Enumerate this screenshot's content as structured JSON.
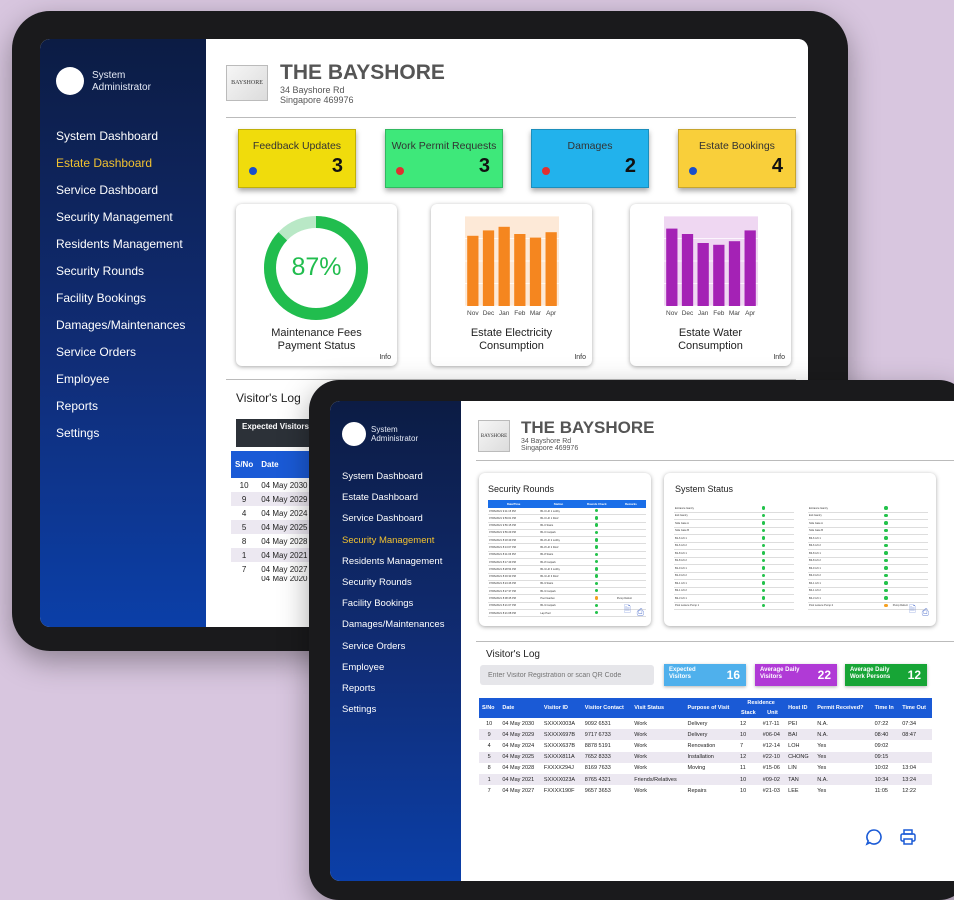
{
  "admin_label": "System Administrator",
  "nav_items": [
    "System Dashboard",
    "Estate Dashboard",
    "Service Dashboard",
    "Security Management",
    "Residents Management",
    "Security Rounds",
    "Facility Bookings",
    "Damages/Maintenances",
    "Service Orders",
    "Employee",
    "Reports",
    "Settings"
  ],
  "property": {
    "logo_text": "BAYSHORE",
    "name": "THE BAYSHORE",
    "address1": "34 Bayshore Rd",
    "address2": "Singapore 469976"
  },
  "tablet1": {
    "active_nav": "Estate Dashboard",
    "cards": [
      {
        "label": "Feedback Updates",
        "count": "3",
        "bg": "#f0dc0c",
        "dot": "#1a4fc9"
      },
      {
        "label": "Work Permit Requests",
        "count": "3",
        "bg": "#3ee87a",
        "dot": "#e03030"
      },
      {
        "label": "Damages",
        "count": "2",
        "bg": "#22b2ec",
        "dot": "#e03030"
      },
      {
        "label": "Estate Bookings",
        "count": "4",
        "bg": "#f9cf3a",
        "dot": "#1a4fc9"
      }
    ],
    "maintenance": {
      "percent_label": "87%",
      "value": 0.87,
      "title1": "Maintenance Fees",
      "title2": "Payment Status",
      "info": "Info"
    },
    "electricity": {
      "title1": "Estate Electricity",
      "title2": "Consumption",
      "info": "Info",
      "categories": [
        "Nov",
        "Dec",
        "Jan",
        "Feb",
        "Mar",
        "Apr"
      ],
      "values": [
        0.78,
        0.84,
        0.88,
        0.8,
        0.76,
        0.82
      ],
      "color": "#f5861f"
    },
    "water": {
      "title1": "Estate Water",
      "title2": "Consumption",
      "info": "Info",
      "categories": [
        "Nov",
        "Dec",
        "Jan",
        "Feb",
        "Mar",
        "Apr"
      ],
      "values": [
        0.86,
        0.8,
        0.7,
        0.68,
        0.72,
        0.84
      ],
      "color": "#a422b5"
    },
    "visitors_log": {
      "title": "Visitor's Log",
      "expected_label": "Expected Visitors",
      "columns": [
        "S/No",
        "Date"
      ],
      "rows": [
        [
          "10",
          "04 May 2030"
        ],
        [
          "9",
          "04 May 2029"
        ],
        [
          "4",
          "04 May 2024"
        ],
        [
          "5",
          "04 May 2025"
        ],
        [
          "8",
          "04 May 2028"
        ],
        [
          "1",
          "04 May 2021"
        ],
        [
          "7",
          "04 May 2027"
        ]
      ],
      "cut_row": "04 May 2020"
    }
  },
  "tablet2": {
    "active_nav": "Security Management",
    "security_rounds": {
      "title": "Security Rounds",
      "columns": [
        "Date/Time",
        "Station",
        "Rounds Check",
        "Remarks"
      ],
      "rows": [
        [
          "07/06/2021 9:11:15 PM",
          "B1-6 Lift 1 Lobby",
          "g",
          ""
        ],
        [
          "07/06/2021 9:59:01 PM",
          "B1-6 Lift 1 Roof",
          "g",
          ""
        ],
        [
          "07/06/2021 9:56:15 PM",
          "B1-6 Stairs",
          "g",
          ""
        ],
        [
          "07/06/2021 9:56:29 PM",
          "B1-6 Carpark",
          "g",
          ""
        ],
        [
          "07/06/2021 8:18:49 PM",
          "B1-8 Lift 2 Lobby",
          "g",
          ""
        ],
        [
          "07/06/2021 8:13:07 PM",
          "B1-8 Lift 2 Roof",
          "g",
          ""
        ],
        [
          "07/06/2021 8:11:06 PM",
          "B1-8 Stairs",
          "g",
          ""
        ],
        [
          "07/06/2021 8:17:49 PM",
          "B1-8 Carpark",
          "g",
          ""
        ],
        [
          "07/06/2021 8:28:54 PM",
          "B1-9 Lift 3 Lobby",
          "g",
          ""
        ],
        [
          "07/06/2021 8:03:33 PM",
          "B1-9 Lift 3 Roof",
          "g",
          ""
        ],
        [
          "07/06/2021 8:24:46 PM",
          "B1-9 Stairs",
          "g",
          ""
        ],
        [
          "07/06/2021 8:27:37 PM",
          "B1-9 Carpark",
          "g",
          ""
        ],
        [
          "07/06/2021 8:08:45 PM",
          "Pool Garden",
          "o",
          "Pump Defect"
        ],
        [
          "07/06/2021 8:21:07 PM",
          "B1-9 Carpark",
          "g",
          ""
        ],
        [
          "07/06/2021 8:21:08 PM",
          "Lap Pool",
          "g",
          ""
        ]
      ]
    },
    "system_status": {
      "title": "System Status",
      "left": [
        [
          "Entrance Gantry",
          "g"
        ],
        [
          "Exit Gantry",
          "g"
        ],
        [
          "Side Gate A",
          "g"
        ],
        [
          "Side Gate B",
          "g"
        ],
        [
          "B1-6 Lift 1",
          "g"
        ],
        [
          "B1-6 Lift 2",
          "g"
        ],
        [
          "B1-8 Lift 1",
          "g"
        ],
        [
          "B1-8 Lift 2",
          "g"
        ],
        [
          "B1-9 Lift 1",
          "g"
        ],
        [
          "B1-9 Lift 2",
          "g"
        ],
        [
          "B2-1 Lift 1",
          "g"
        ],
        [
          "B2-1 Lift 2",
          "g"
        ],
        [
          "B2-3 Lift 1",
          "g"
        ],
        [
          "Pool Leisure Pump 1",
          "g"
        ]
      ],
      "right": [
        [
          "Entrance Gantry",
          "g"
        ],
        [
          "Exit Gantry",
          "g"
        ],
        [
          "Side Gate A",
          "g"
        ],
        [
          "Side Gate B",
          "g"
        ],
        [
          "B3-6 Lift 1",
          "g"
        ],
        [
          "B3-6 Lift 2",
          "g"
        ],
        [
          "B3-8 Lift 1",
          "g"
        ],
        [
          "B3-8 Lift 2",
          "g"
        ],
        [
          "B3-9 Lift 1",
          "g"
        ],
        [
          "B3-9 Lift 2",
          "g"
        ],
        [
          "B4-1 Lift 1",
          "g"
        ],
        [
          "B4-1 Lift 2",
          "g"
        ],
        [
          "B4-3 Lift 1",
          "g"
        ],
        [
          "Pool Leisure Pump 2",
          "o",
          "Pump Defect"
        ]
      ]
    },
    "visitors_log": {
      "title": "Visitor's Log",
      "search_placeholder": "Enter Visitor Registration or scan QR Code",
      "stats": [
        {
          "label": "Expected Visitors",
          "value": "16",
          "bg": "#4fb0ec"
        },
        {
          "label": "Average Daily Visitors",
          "value": "22",
          "bg": "#b03ad6"
        },
        {
          "label": "Average Daily Work Persons",
          "value": "12",
          "bg": "#17a536"
        }
      ],
      "columns": [
        "S/No",
        "Date",
        "Visitor ID",
        "Visitor Contact",
        "Visit Status",
        "Purpose of Visit",
        "Residence",
        "Host ID",
        "Permit Received?",
        "Time In",
        "Time Out"
      ],
      "residence_sub": [
        "Stack",
        "Unit"
      ],
      "rows": [
        [
          "10",
          "04 May 2030",
          "SXXXX003A",
          "9092 6531",
          "Work",
          "Delivery",
          "12",
          "#17-11",
          "PEI",
          "N.A.",
          "07:22",
          "07:34"
        ],
        [
          "9",
          "04 May 2029",
          "SXXXX697B",
          "9717 6733",
          "Work",
          "Delivery",
          "10",
          "#06-04",
          "BAI",
          "N.A.",
          "08:40",
          "08:47"
        ],
        [
          "4",
          "04 May 2024",
          "SXXXX637B",
          "8878 5191",
          "Work",
          "Renovation",
          "7",
          "#12-14",
          "LOH",
          "Yes",
          "09:02",
          ""
        ],
        [
          "5",
          "04 May 2025",
          "SXXXX811A",
          "7652 8333",
          "Work",
          "Installation",
          "12",
          "#22-10",
          "CHONG",
          "Yes",
          "09:15",
          ""
        ],
        [
          "8",
          "04 May 2028",
          "FXXXX294J",
          "8169 7633",
          "Work",
          "Moving",
          "11",
          "#15-06",
          "LIN",
          "Yes",
          "10:02",
          "13:04"
        ],
        [
          "1",
          "04 May 2021",
          "SXXXX023A",
          "8765 4321",
          "Friends/Relatives",
          "",
          "10",
          "#09-02",
          "TAN",
          "N.A.",
          "10:34",
          "13:24"
        ],
        [
          "7",
          "04 May 2027",
          "FXXXX190F",
          "9657 3653",
          "Work",
          "Repairs",
          "10",
          "#21-03",
          "LEE",
          "Yes",
          "11:05",
          "12:22"
        ]
      ]
    }
  }
}
